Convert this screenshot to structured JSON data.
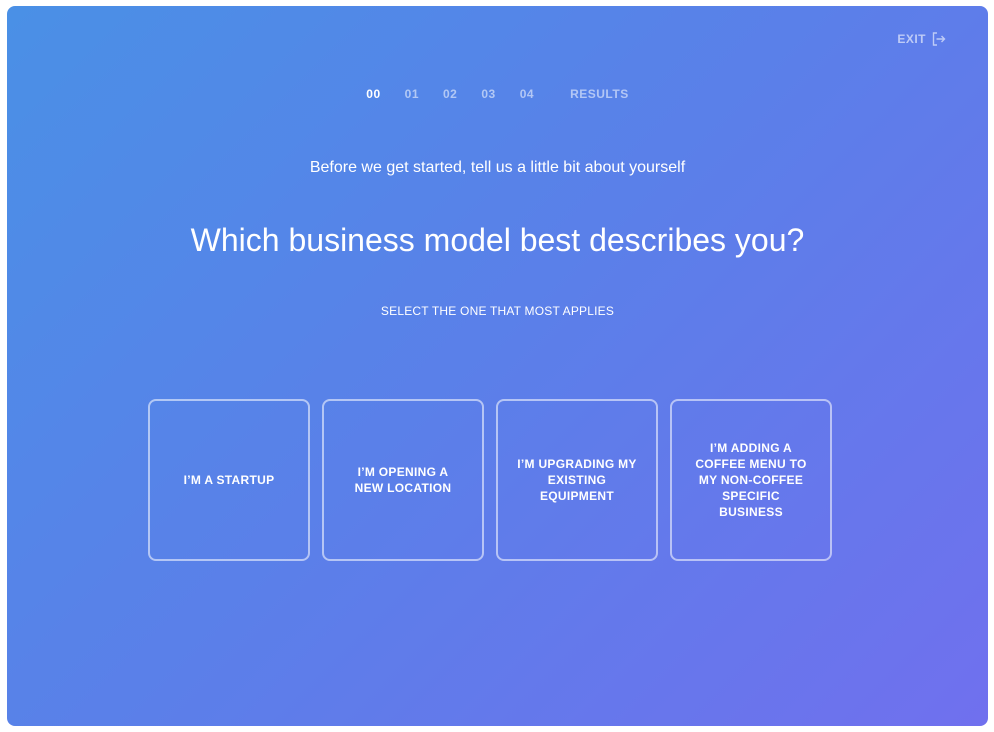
{
  "header": {
    "exit_label": "EXIT",
    "exit_icon": "exit-arrow-icon"
  },
  "steps": [
    {
      "label": "00",
      "active": true
    },
    {
      "label": "01",
      "active": false
    },
    {
      "label": "02",
      "active": false
    },
    {
      "label": "03",
      "active": false
    },
    {
      "label": "04",
      "active": false
    },
    {
      "label": "RESULTS",
      "active": false
    }
  ],
  "intro": "Before we get started, tell us a little bit about yourself",
  "question": "Which business model best describes you?",
  "instruction": "SELECT THE ONE THAT MOST APPLIES",
  "options": [
    {
      "label": "I’M A STARTUP"
    },
    {
      "label": "I’M OPENING A NEW LOCATION"
    },
    {
      "label": "I’M UPGRADING MY EXISTING EQUIPMENT"
    },
    {
      "label": "I’M ADDING A COFFEE MENU TO MY NON-COFFEE SPECIFIC BUSINESS"
    }
  ],
  "colors": {
    "gradient_start": "#4a90e6",
    "gradient_end": "#7070ee",
    "text": "#ffffff"
  }
}
